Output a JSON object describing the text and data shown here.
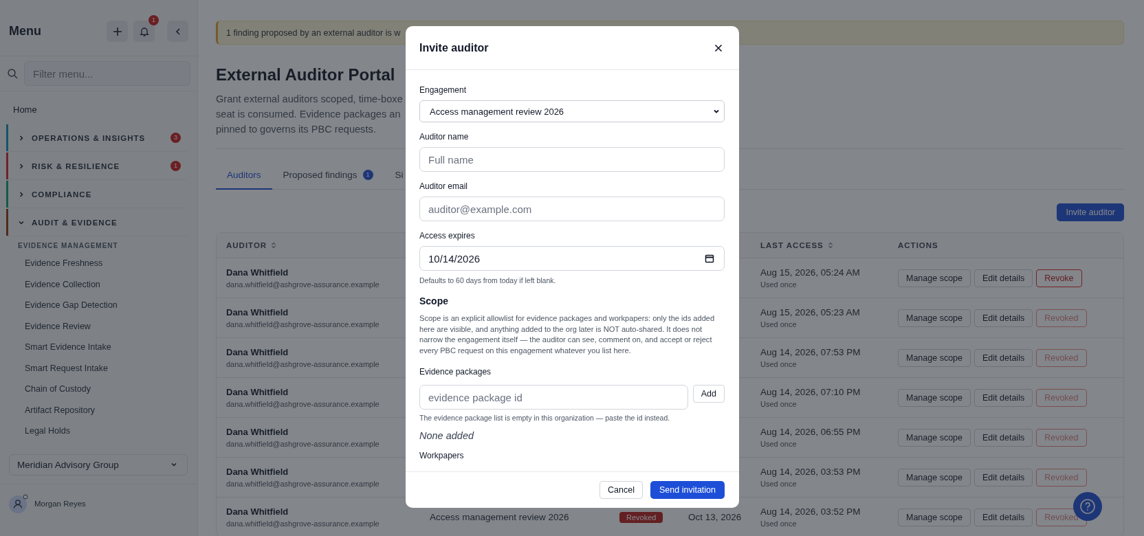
{
  "sidebar": {
    "title": "Menu",
    "notification_count": "1",
    "filter_placeholder": "Filter menu...",
    "home": "Home",
    "sections": [
      {
        "label": "OPERATIONS & INSIGHTS",
        "expanded": false,
        "color": "#17546a",
        "badge": "3"
      },
      {
        "label": "RISK & RESILIENCE",
        "expanded": false,
        "color": "#6e2428",
        "badge": "1"
      },
      {
        "label": "COMPLIANCE",
        "expanded": false,
        "color": "#175947"
      },
      {
        "label": "AUDIT & EVIDENCE",
        "expanded": true,
        "color": "#4f2d1e",
        "group": "EVIDENCE MANAGEMENT",
        "items": [
          "Evidence Freshness",
          "Evidence Collection",
          "Evidence Gap Detection",
          "Evidence Review",
          "Smart Evidence Intake",
          "Smart Request Intake",
          "Chain of Custody",
          "Artifact Repository",
          "Legal Holds"
        ]
      }
    ],
    "org": "Meridian Advisory Group",
    "user": "Morgan Reyes"
  },
  "alert": "1 finding proposed by an external auditor is w",
  "page": {
    "title": "External Auditor Portal",
    "description_lines": [
      "Grant external auditors scoped, time-boxe",
      "seat is consumed. Evidence packages an",
      "pinned to governs its PBC requests."
    ]
  },
  "tabs": [
    {
      "label": "Auditors",
      "selected": true
    },
    {
      "label": "Proposed findings",
      "badge": "1",
      "selected": false
    },
    {
      "label": "Si",
      "selected": false
    }
  ],
  "invite_button": "Invite auditor",
  "table": {
    "columns": {
      "auditor": "AUDITOR",
      "last_access": "LAST ACCESS",
      "actions": "ACTIONS"
    },
    "rows": [
      {
        "name": "Dana Whitfield",
        "email": "dana.whitfield@ashgrove-assurance.example",
        "last_access": "Aug 15, 2026, 05:24 AM",
        "usage": "Used once",
        "manage": "Manage scope",
        "edit": "Edit details",
        "revoke": "Revoke",
        "revoke_disabled": false
      },
      {
        "name": "Dana Whitfield",
        "email": "dana.whitfield@ashgrove-assurance.example",
        "last_access": "Aug 15, 2026, 05:23 AM",
        "usage": "Used once",
        "manage": "Manage scope",
        "edit": "Edit details",
        "revoke": "Revoked",
        "revoke_disabled": true
      },
      {
        "name": "Dana Whitfield",
        "email": "dana.whitfield@ashgrove-assurance.example",
        "last_access": "Aug 14, 2026, 07:53 PM",
        "usage": "Used once",
        "manage": "Manage scope",
        "edit": "Edit details",
        "revoke": "Revoked",
        "revoke_disabled": true
      },
      {
        "name": "Dana Whitfield",
        "email": "dana.whitfield@ashgrove-assurance.example",
        "last_access": "Aug 14, 2026, 07:10 PM",
        "usage": "Used once",
        "manage": "Manage scope",
        "edit": "Edit details",
        "revoke": "Revoked",
        "revoke_disabled": true
      },
      {
        "name": "Dana Whitfield",
        "email": "dana.whitfield@ashgrove-assurance.example",
        "last_access": "Aug 14, 2026, 06:55 PM",
        "usage": "Used once",
        "manage": "Manage scope",
        "edit": "Edit details",
        "revoke": "Revoked",
        "revoke_disabled": true
      },
      {
        "name": "Dana Whitfield",
        "email": "dana.whitfield@ashgrove-assurance.example",
        "last_access": "Aug 14, 2026, 03:53 PM",
        "usage": "Used once",
        "manage": "Manage scope",
        "edit": "Edit details",
        "revoke": "Revoked",
        "revoke_disabled": true
      },
      {
        "name": "Dana Whitfield",
        "email": "dana.whitfield@ashgrove-assurance.example",
        "engagement": "Access management review 2026",
        "status": "Revoked",
        "expires": "Oct 13, 2026",
        "last_access": "Aug 14, 2026, 03:52 PM",
        "usage": "Used once",
        "manage": "Manage scope",
        "edit": "Edit details",
        "revoke": "Revoked",
        "revoke_disabled": true
      }
    ]
  },
  "modal": {
    "title": "Invite auditor",
    "fields": [
      {
        "kind": "select",
        "label": "Engagement",
        "value": "Access management review 2026"
      },
      {
        "kind": "text",
        "label": "Auditor name",
        "placeholder": "Full name"
      },
      {
        "kind": "text",
        "label": "Auditor email",
        "placeholder": "auditor@example.com"
      },
      {
        "kind": "date",
        "label": "Access expires",
        "value": "10/14/2026",
        "hint": "Defaults to 60 days from today if left blank."
      }
    ],
    "scope": {
      "heading": "Scope",
      "text": "Scope is an explicit allowlist for evidence packages and workpapers: only the ids added here are visible, and anything added to the org later is NOT auto-shared. It does not narrow the engagement itself — the auditor can see, comment on, and accept or reject every PBC request on this engagement whatever you list here.",
      "packages": {
        "label": "Evidence packages",
        "placeholder": "evidence package id",
        "add": "Add",
        "hint": "The evidence package list is empty in this organization — paste the id instead.",
        "empty": "None added"
      },
      "workpapers_label": "Workpapers"
    },
    "cancel": "Cancel",
    "submit": "Send invitation"
  }
}
